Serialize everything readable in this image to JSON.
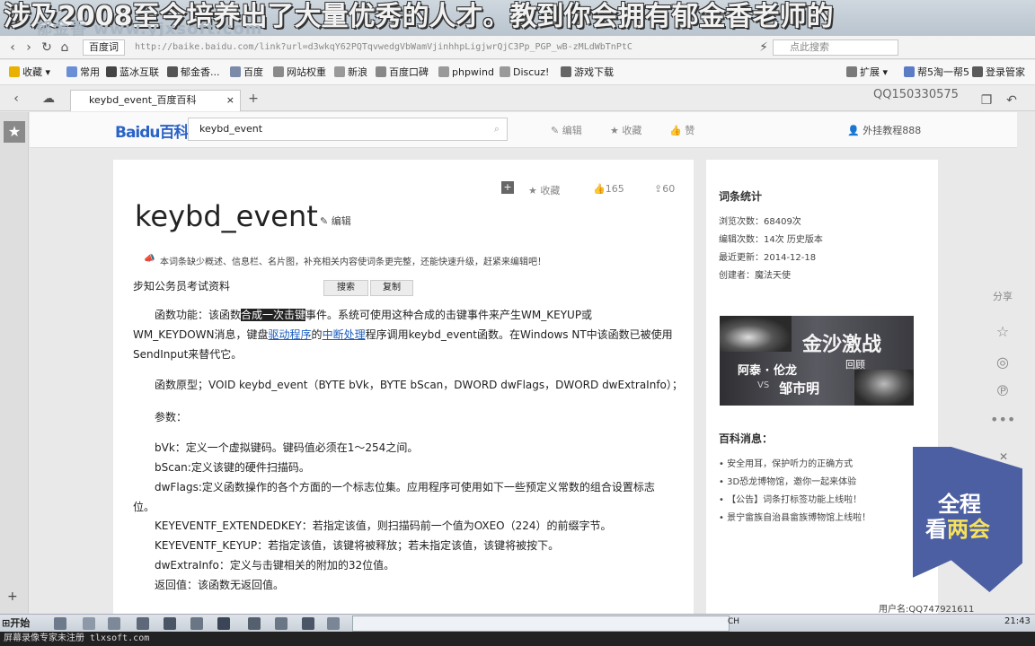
{
  "overlay": {
    "caption": "涉及2008至今培养出了大量优秀的人才。教到你会拥有郁金香老师的",
    "watermark": "郁金香 www.yjxsoft.com"
  },
  "browser": {
    "site_chip": "百度词",
    "url": "http://baike.baidu.com/link?url=d3wkqY62PQTqvwedgVbWamVjinhhpLigjwrQjC3Pp_PGP_wB-zMLdWbTnPtC",
    "search_placeholder": "点此搜索",
    "bookmarks": [
      "收藏",
      "常用",
      "蓝冰互联",
      "郁金香...",
      "百度",
      "网站权重",
      "新浪",
      "百度口碑",
      "phpwind",
      "Discuz!",
      "游戏下载"
    ],
    "bookmarks_right": [
      "扩展",
      "帮5淘一帮5",
      "登录管家"
    ],
    "tab_title": "keybd_event_百度百科",
    "qq_label": "QQ150330575"
  },
  "baike_header": {
    "logo": "Baidu百科",
    "search_value": "keybd_event",
    "actions": [
      "编辑",
      "收藏",
      "赞"
    ],
    "user": "外挂教程888"
  },
  "article": {
    "title": "keybd_event",
    "edit": "编辑",
    "collect": "收藏",
    "likes": "165",
    "shares": "60",
    "notice": "本词条缺少概述、信息栏、名片图，补充相关内容使词条更完整，还能快速升级，赶紧来编辑吧！",
    "subhead": "步知公务员考试资料",
    "popup_search": "搜索",
    "popup_copy": "复制",
    "p1_pre": "函数功能：该函数",
    "p1_hl": "合成一次击键",
    "p1_post": "事件。系统可使用这种合成的击键事件来产生WM_KEYUP或",
    "p1_line2_pre": "WM_KEYDOWN消息，键盘",
    "p1_link1": "驱动程序",
    "p1_mid": "的",
    "p1_link2": "中断处理",
    "p1_line2_post": "程序调用keybd_event函数。在Windows NT中该函数已被使用",
    "p1_line3": "SendInput来替代它。",
    "proto": "函数原型；VOID keybd_event（BYTE bVk，BYTE bScan，DWORD dwFlags，DWORD dwExtraInfo）；",
    "params_label": "参数：",
    "bvk": "bVk：定义一个虚拟键码。键码值必须在1～254之间。",
    "bscan": "bScan:定义该键的硬件扫描码。",
    "dwflags1": "dwFlags:定义函数操作的各个方面的一个标志位集。应用程序可使用如下一些预定义常数的组合设置标志",
    "dwflags2": "位。",
    "ext": "KEYEVENTF_EXTENDEDKEY：若指定该值，则扫描码前一个值为OXEO（224）的前缀字节。",
    "keyup": "KEYEVENTF_KEYUP：若指定该值，该键将被释放；若未指定该值，该键将被按下。",
    "extra": "dwExtraInfo：定义与击键相关的附加的32位值。",
    "ret": "返回值：该函数无返回值。"
  },
  "sidebar": {
    "stats_title": "词条统计",
    "views": "浏览次数：68409次",
    "edits": "编辑次数：14次 历史版本",
    "updated": "最近更新：2014-12-18",
    "creator": "创建者：魔法天使",
    "banner_title": "金沙激战",
    "banner_names": "阿泰 · 伦龙",
    "banner_review": "回顾",
    "banner_vs": "VS",
    "banner_opponent": "邹市明",
    "news_title": "百科消息：",
    "news": [
      "安全用耳，保护听力的正确方式",
      "3D恐龙博物馆，邀你一起来体验",
      "【公告】词条打标签功能上线啦！",
      "景宁畲族自治县畲族博物馆上线啦！"
    ],
    "share": "分享",
    "promo_line1": "全程",
    "promo_line2a": "看",
    "promo_line2b": "两会",
    "user_bottom": "用户名:QQ747921611"
  },
  "taskbar": {
    "start": "开始",
    "lang": "CH",
    "clock": "21:43"
  },
  "footer": {
    "text": "屏幕录像专家未注册 tlxsoft.com"
  },
  "colors": {
    "link": "#1a5dbf",
    "baidu_blue": "#2a63c7",
    "promo": "#4c5fa2"
  }
}
